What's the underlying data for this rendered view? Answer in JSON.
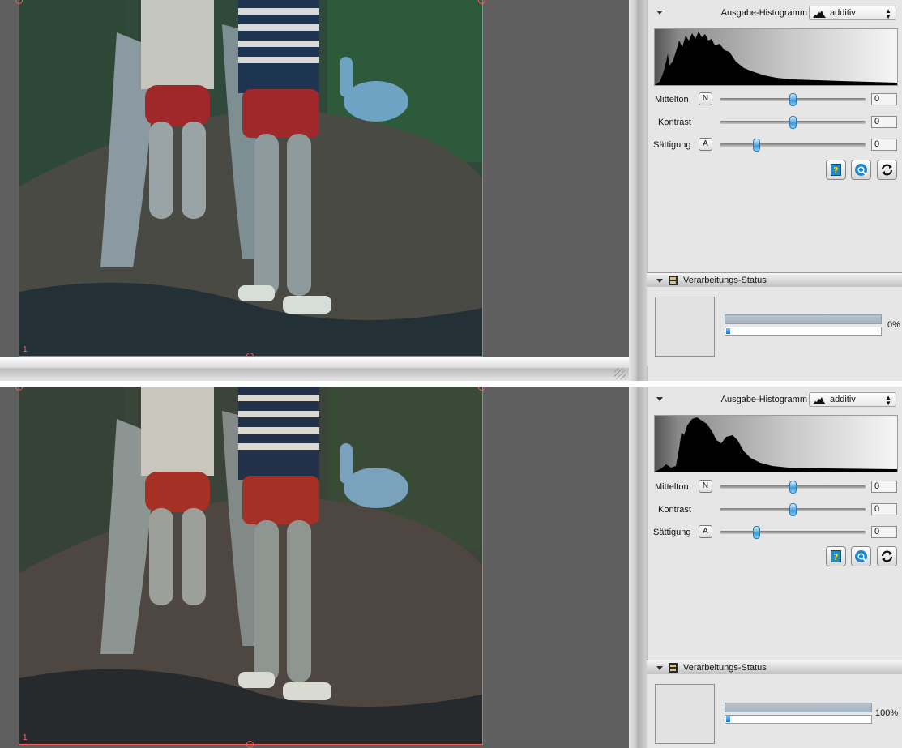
{
  "panes": [
    {
      "id": "top",
      "frame_number": "1",
      "output": {
        "histogram_label": "Ausgabe-Histogramm",
        "histogram_mode": "additiv"
      },
      "sliders": [
        {
          "label": "Mittelton",
          "button": "N",
          "value": "0",
          "level": 0.5
        },
        {
          "label": "Kontrast",
          "button": "",
          "value": "0",
          "level": 0.5
        },
        {
          "label": "Sättigung",
          "button": "A",
          "value": "0",
          "level": 0.25
        }
      ],
      "status": {
        "title": "Verarbeitungs-Status",
        "percent_text": "0%",
        "progress": 0.0
      }
    },
    {
      "id": "bottom",
      "frame_number": "1",
      "output": {
        "histogram_label": "Ausgabe-Histogramm",
        "histogram_mode": "additiv"
      },
      "sliders": [
        {
          "label": "Mittelton",
          "button": "N",
          "value": "0",
          "level": 0.5
        },
        {
          "label": "Kontrast",
          "button": "",
          "value": "0",
          "level": 0.5
        },
        {
          "label": "Sättigung",
          "button": "A",
          "value": "0",
          "level": 0.25
        }
      ],
      "status": {
        "title": "Verarbeitungs-Status",
        "percent_text": "100%",
        "progress": 1.0
      }
    }
  ],
  "icons": [
    "help-icon",
    "preview-icon",
    "reset-icon",
    "histogram-icon",
    "status-icon"
  ],
  "colors": {
    "frame": "#ff5b5b",
    "accent": "#2a79b4",
    "panel": "#e6e6e6"
  }
}
